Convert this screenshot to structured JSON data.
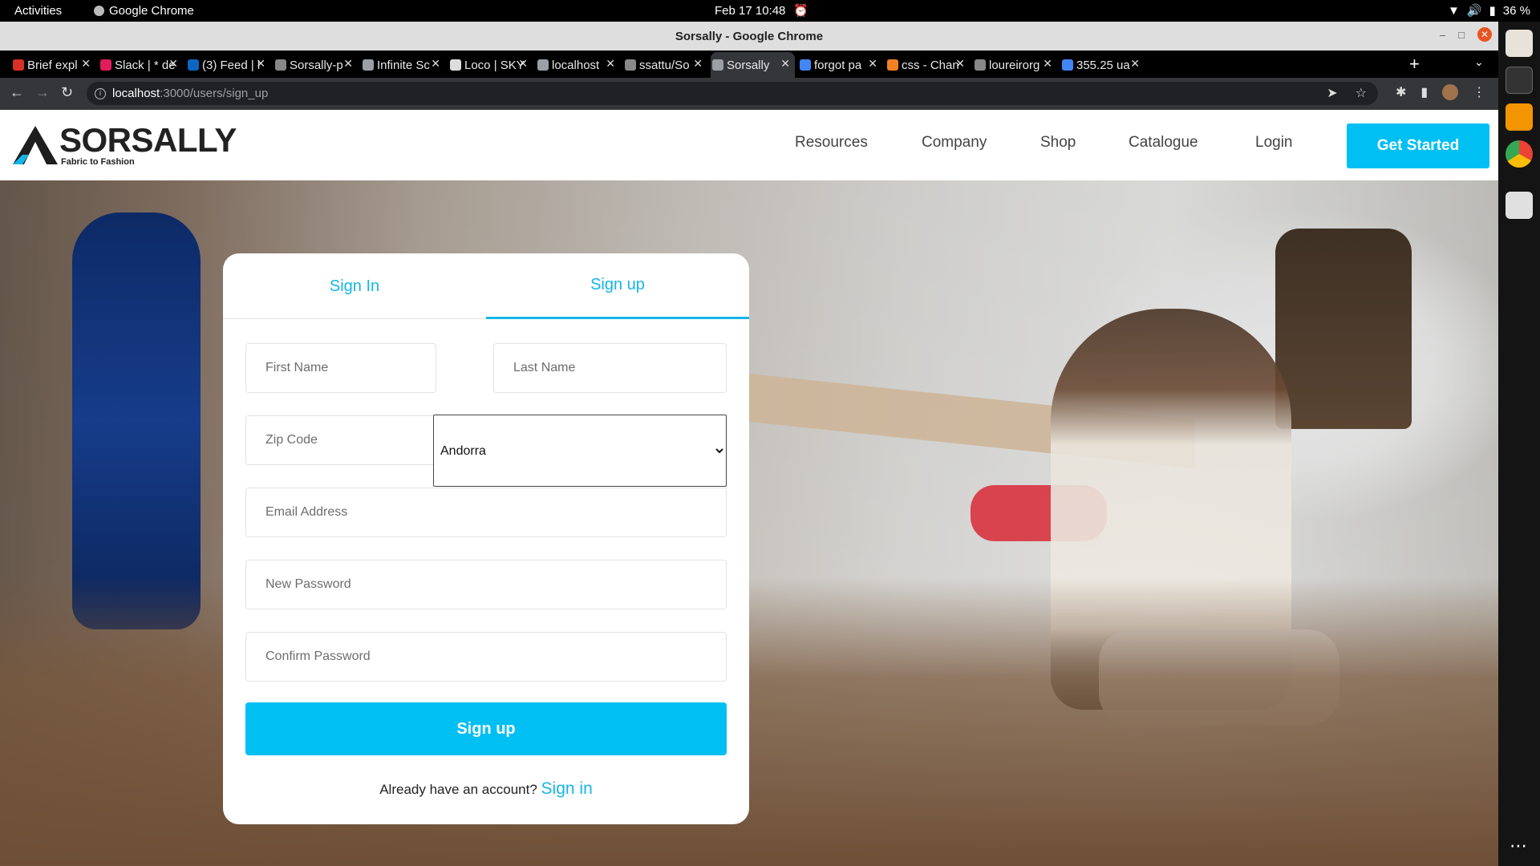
{
  "system": {
    "activities": "Activities",
    "app_name": "Google Chrome",
    "datetime": "Feb 17  10:48",
    "battery": "36 %"
  },
  "window": {
    "title": "Sorsally - Google Chrome"
  },
  "tabs": [
    {
      "label": "Brief expl",
      "favicon_color": "#d93025"
    },
    {
      "label": "Slack | * de",
      "favicon_color": "#e01e5a"
    },
    {
      "label": "(3) Feed | l",
      "favicon_color": "#0a66c2"
    },
    {
      "label": "Sorsally-p",
      "favicon_color": "#888888"
    },
    {
      "label": "Infinite Sc",
      "favicon_color": "#9aa0a6"
    },
    {
      "label": "Loco | SKY",
      "favicon_color": "#dddddd"
    },
    {
      "label": "localhost",
      "favicon_color": "#9aa0a6"
    },
    {
      "label": "ssattu/So",
      "favicon_color": "#888888"
    },
    {
      "label": "Sorsally",
      "favicon_color": "#9aa0a6"
    },
    {
      "label": "forgot pa",
      "favicon_color": "#4285f4"
    },
    {
      "label": "css - Chan",
      "favicon_color": "#f48024"
    },
    {
      "label": "loureirorg",
      "favicon_color": "#888888"
    },
    {
      "label": "355.25 ua",
      "favicon_color": "#4285f4"
    }
  ],
  "active_tab_index": 8,
  "address": {
    "host": "localhost",
    "path": ":3000/users/sign_up"
  },
  "site": {
    "brand": "SORSALLY",
    "tagline": "Fabric to Fashion",
    "nav": [
      "Resources",
      "Company",
      "Shop",
      "Catalogue",
      "Login"
    ],
    "cta": "Get Started"
  },
  "form": {
    "tab_signin": "Sign In",
    "tab_signup": "Sign up",
    "active_tab": "Sign up",
    "first_name_placeholder": "First Name",
    "last_name_placeholder": "Last Name",
    "zip_placeholder": "Zip Code",
    "country_selected": "Andorra",
    "email_placeholder": "Email Address",
    "password_placeholder": "New Password",
    "confirm_placeholder": "Confirm Password",
    "submit_label": "Sign up",
    "footer_text": "Already have an account?",
    "footer_link": "Sign in"
  },
  "colors": {
    "accent": "#00bff3",
    "link": "#14b6e8"
  }
}
